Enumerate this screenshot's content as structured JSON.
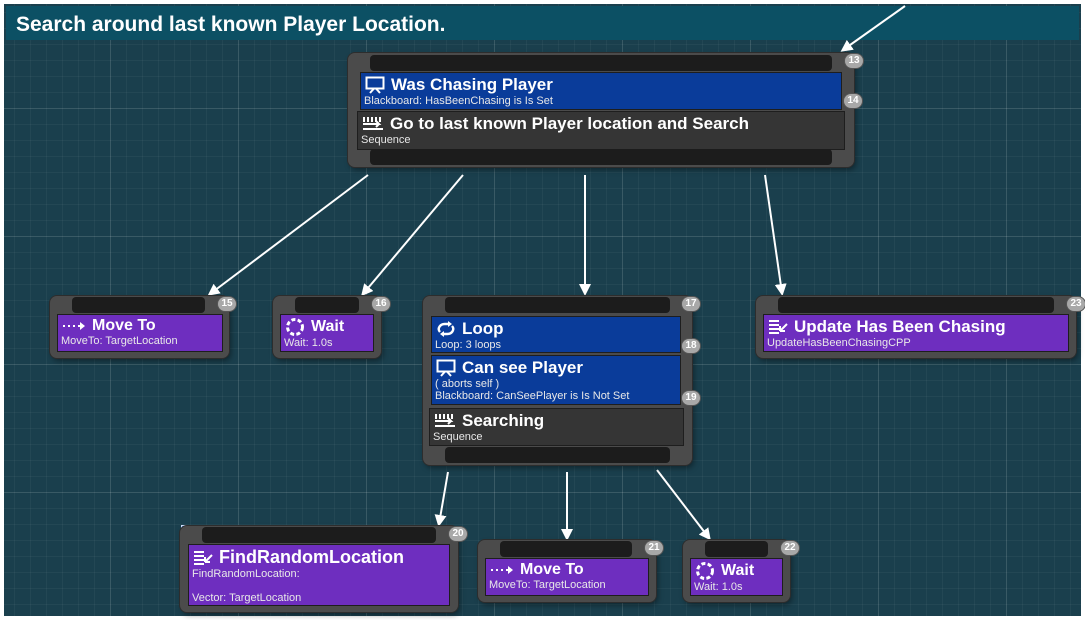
{
  "comment": {
    "title": "Search around last known Player Location."
  },
  "root": {
    "id": "13",
    "decorator": {
      "title": "Was Chasing Player",
      "subtitle": "Blackboard: HasBeenChasing is Is Set",
      "id": "14"
    },
    "composite": {
      "title": "Go to last known Player location and Search",
      "subtitle": "Sequence"
    }
  },
  "children": [
    {
      "id": "15",
      "title": "Move To",
      "subtitle": "MoveTo: TargetLocation",
      "icon": "move-to-icon"
    },
    {
      "id": "16",
      "title": "Wait",
      "subtitle": "Wait: 1.0s",
      "icon": "wait-icon"
    },
    {
      "id": "23",
      "title": "Update Has Been Chasing",
      "subtitle": "UpdateHasBeenChasingCPP",
      "icon": "task-icon"
    }
  ],
  "searching": {
    "id": "17",
    "loop": {
      "title": "Loop",
      "subtitle": "Loop: 3 loops",
      "id": "18"
    },
    "can_see": {
      "title": "Can see Player",
      "subtitle1": "( aborts self )",
      "subtitle2": "Blackboard: CanSeePlayer is Is Not Set",
      "id": "19"
    },
    "composite": {
      "title": "Searching",
      "subtitle": "Sequence"
    }
  },
  "grandchildren": [
    {
      "id": "20",
      "title": "FindRandomLocation",
      "subtitle1": "FindRandomLocation:",
      "subtitle2": "Vector: TargetLocation",
      "icon": "task-icon"
    },
    {
      "id": "21",
      "title": "Move To",
      "subtitle": "MoveTo: TargetLocation",
      "icon": "move-to-icon"
    },
    {
      "id": "22",
      "title": "Wait",
      "subtitle": "Wait: 1.0s",
      "icon": "wait-icon"
    }
  ],
  "colors": {
    "decorator": "#0a3c9a",
    "composite": "#353535",
    "task": "#6e2ebf",
    "comment": "#0c5064",
    "grid": "#1a3f4d"
  }
}
